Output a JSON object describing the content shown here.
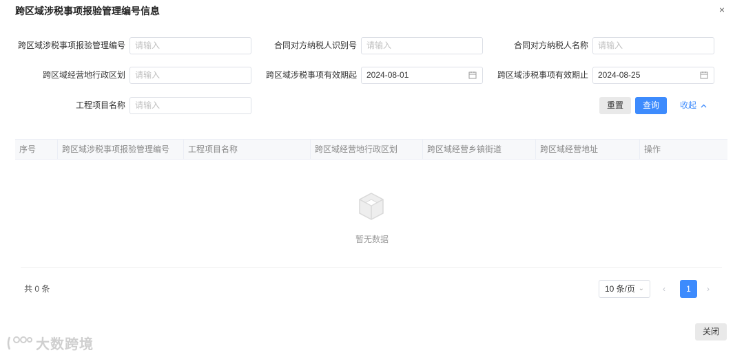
{
  "dialog": {
    "title": "跨区域涉税事项报验管理编号信息",
    "close_glyph": "×"
  },
  "form": {
    "fields": [
      {
        "label": "跨区域涉税事项报验管理编号",
        "value": "",
        "placeholder": "请输入"
      },
      {
        "label": "合同对方纳税人识别号",
        "value": "",
        "placeholder": "请输入"
      },
      {
        "label": "合同对方纳税人名称",
        "value": "",
        "placeholder": "请输入"
      },
      {
        "label": "跨区域经营地行政区划",
        "value": "",
        "placeholder": "请输入"
      },
      {
        "label": "跨区域涉税事项有效期起",
        "value": "2024-08-01",
        "placeholder": ""
      },
      {
        "label": "跨区域涉税事项有效期止",
        "value": "2024-08-25",
        "placeholder": ""
      },
      {
        "label": "工程项目名称",
        "value": "",
        "placeholder": "请输入"
      }
    ],
    "reset_label": "重置",
    "query_label": "查询",
    "collapse_label": "收起"
  },
  "table": {
    "columns": [
      "序号",
      "跨区域涉税事项报验管理编号",
      "工程项目名称",
      "跨区域经营地行政区划",
      "跨区域经营乡镇街道",
      "跨区域经营地址",
      "操作"
    ],
    "rows": [],
    "empty_text": "暂无数据"
  },
  "pagination": {
    "total_text": "共 0 条",
    "page_size": "10 条/页",
    "current_page": "1",
    "prev_glyph": "‹",
    "next_glyph": "›"
  },
  "footer": {
    "close_label": "关闭"
  },
  "watermark": {
    "text": "大数跨境"
  },
  "colors": {
    "primary": "#3d8bfd",
    "border": "#dcdfe6",
    "header_bg": "#f7f8fa"
  }
}
